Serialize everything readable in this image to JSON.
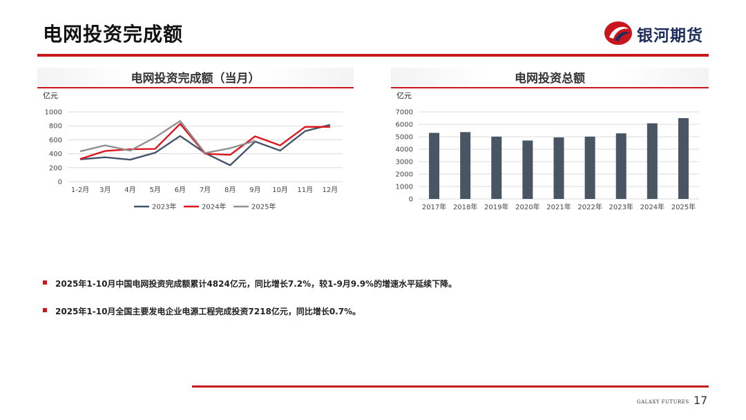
{
  "header": {
    "title": "电网投资完成额",
    "logo_text": "银河期货"
  },
  "colors": {
    "accent": "#c8161d",
    "series_2023": "#44546a",
    "series_2024": "#e0161e",
    "series_2025": "#909090",
    "bar": "#4a5563"
  },
  "chart_data": [
    {
      "type": "line",
      "title": "电网投资完成额（当月）",
      "ylabel": "亿元",
      "categories": [
        "1-2月",
        "3月",
        "4月",
        "5月",
        "6月",
        "7月",
        "8月",
        "9月",
        "10月",
        "11月",
        "12月"
      ],
      "ylim": [
        0,
        1000
      ],
      "yticks": [
        0,
        200,
        400,
        600,
        800,
        1000
      ],
      "legend": "bottom",
      "series": [
        {
          "name": "2023年",
          "color": "#44546a",
          "values": [
            320,
            350,
            315,
            415,
            655,
            410,
            235,
            575,
            445,
            725,
            815
          ]
        },
        {
          "name": "2024年",
          "color": "#e0161e",
          "values": [
            325,
            440,
            465,
            470,
            830,
            400,
            385,
            650,
            520,
            785,
            785
          ]
        },
        {
          "name": "2025年",
          "color": "#909090",
          "values": [
            435,
            520,
            445,
            635,
            870,
            410,
            480,
            585,
            null,
            null,
            null
          ]
        }
      ]
    },
    {
      "type": "bar",
      "title": "电网投资总额",
      "ylabel": "亿元",
      "categories": [
        "2017年",
        "2018年",
        "2019年",
        "2020年",
        "2021年",
        "2022年",
        "2023年",
        "2024年",
        "2025年"
      ],
      "values": [
        5315,
        5374,
        5012,
        4699,
        4951,
        5012,
        5275,
        6083,
        6500
      ],
      "ylim": [
        0,
        7000
      ],
      "yticks": [
        0,
        1000,
        2000,
        3000,
        4000,
        5000,
        6000,
        7000
      ]
    }
  ],
  "bullets": [
    "2025年1-10月中国电网投资完成额累计4824亿元，同比增长7.2%，较1-9月9.9%的增速水平延续下降。",
    "2025年1-10月全国主要发电企业电源工程完成投资7218亿元，同比增长0.7%。"
  ],
  "footer": {
    "brand": "GALAXY FUTURES",
    "page_number": "17"
  }
}
